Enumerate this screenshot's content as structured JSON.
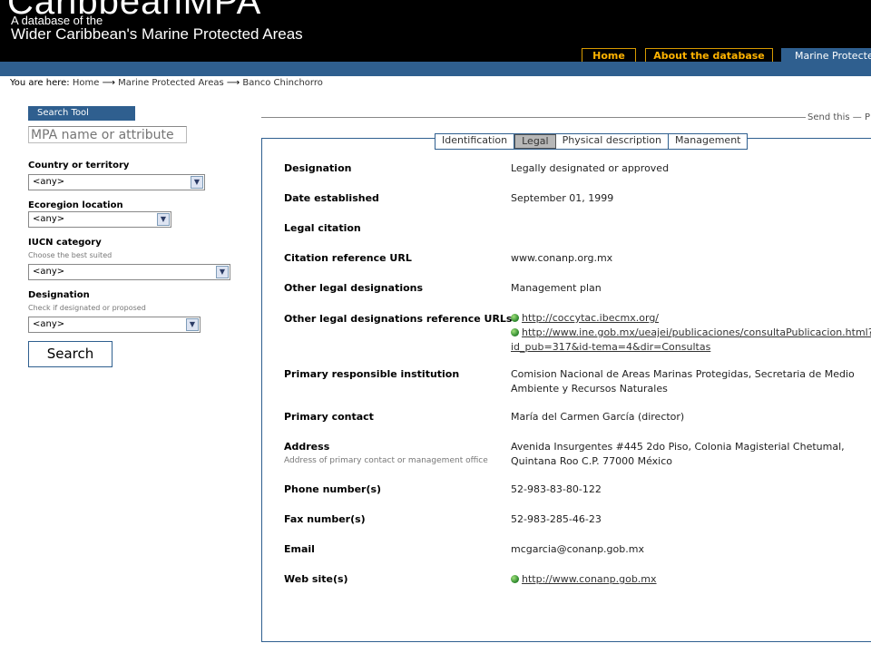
{
  "header": {
    "brand": "CaribbeanMPA",
    "tagline1": "A database of the",
    "tagline2": "Wider Caribbean's Marine Protected Areas"
  },
  "nav": {
    "home": "Home",
    "about": "About the database",
    "mpa": "Marine Protected Areas"
  },
  "breadcrumb": {
    "prefix": "You are here:",
    "items": [
      "Home",
      "Marine Protected Areas",
      "Banco Chinchorro"
    ],
    "separator": "⟶"
  },
  "search": {
    "title": "Search Tool",
    "placeholder": "MPA name or attribute",
    "country_label": "Country or territory",
    "country_value": "<any>",
    "ecoregion_label": "Ecoregion location",
    "ecoregion_value": "<any>",
    "iucn_label": "IUCN category",
    "iucn_hint": "Choose the best suited",
    "iucn_value": "<any>",
    "designation_label": "Designation",
    "designation_hint": "Check if designated or proposed",
    "designation_value": "<any>",
    "button": "Search"
  },
  "send_this": "Send this — P",
  "tabs": [
    "Identification",
    "Legal",
    "Physical description",
    "Management"
  ],
  "active_tab": "Legal",
  "details": {
    "designation_label": "Designation",
    "designation_value": "Legally designated or approved",
    "date_label": "Date established",
    "date_value": "September 01, 1999",
    "citation_label": "Legal citation",
    "citation_url_label": "Citation reference URL",
    "citation_url_value": "www.conanp.org.mx",
    "other_label": "Other legal designations",
    "other_value": "Management plan",
    "other_urls_label": "Other legal designations reference URLs",
    "other_url1": "http://coccytac.ibecmx.org/",
    "other_url2_line1": "http://www.ine.gob.mx/ueajei/publicaciones/consultaPublicacion.html?",
    "other_url2_line2": "id_pub=317&id-tema=4&dir=Consultas",
    "institution_label": "Primary responsible institution",
    "institution_line1": "Comision Nacional de Areas Marinas Protegidas, Secretaria de Medio",
    "institution_line2": "Ambiente y Recursos Naturales",
    "contact_label": "Primary contact",
    "contact_value": "María del Carmen García (director)",
    "address_label": "Address",
    "address_hint": "Address of primary contact or management office",
    "address_line1": "Avenida Insurgentes #445 2do Piso, Colonia Magisterial Chetumal,",
    "address_line2": "Quintana Roo C.P. 77000 México",
    "phone_label": "Phone number(s)",
    "phone_value": "52-983-83-80-122",
    "fax_label": "Fax number(s)",
    "fax_value": "52-983-285-46-23",
    "email_label": "Email",
    "email_value": "mcgarcia@conanp.gob.mx",
    "website_label": "Web site(s)",
    "website_value": "http://www.conanp.gob.mx"
  }
}
